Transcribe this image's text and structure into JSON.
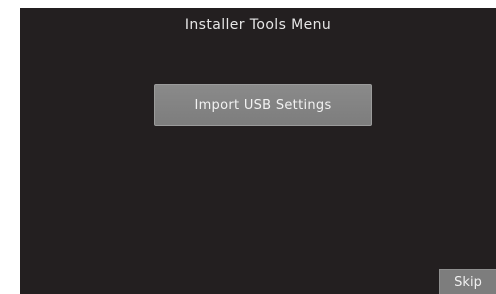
{
  "screen": {
    "title": "Installer Tools Menu",
    "colors": {
      "background": "#231f20",
      "button": "#7d7d7d",
      "text": "#e6e6e6"
    }
  },
  "menu": {
    "import_usb_label": "Import USB Settings"
  },
  "footer": {
    "skip_label": "Skip"
  }
}
